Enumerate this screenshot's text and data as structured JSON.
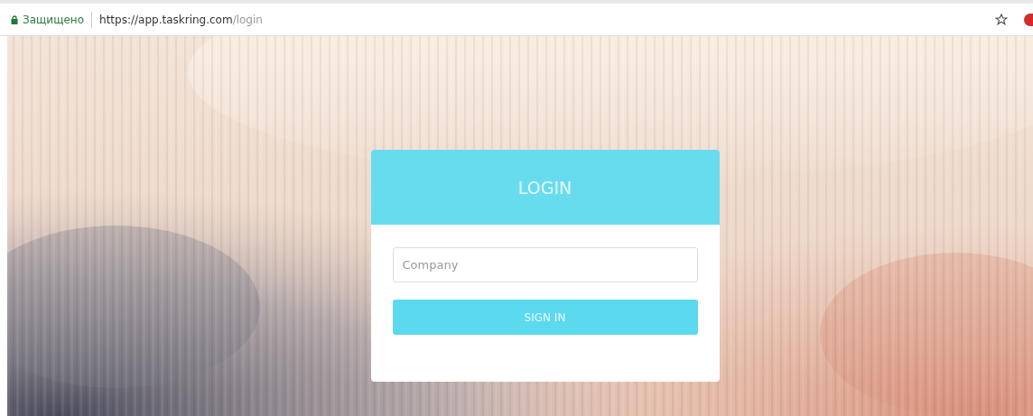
{
  "address_bar": {
    "security_label": "Защищено",
    "url_origin": "https://app.taskring.com",
    "url_path": "/login"
  },
  "login_card": {
    "title": "LOGIN",
    "company_field": {
      "placeholder": "Company"
    },
    "sign_in_button": "SIGN IN"
  }
}
